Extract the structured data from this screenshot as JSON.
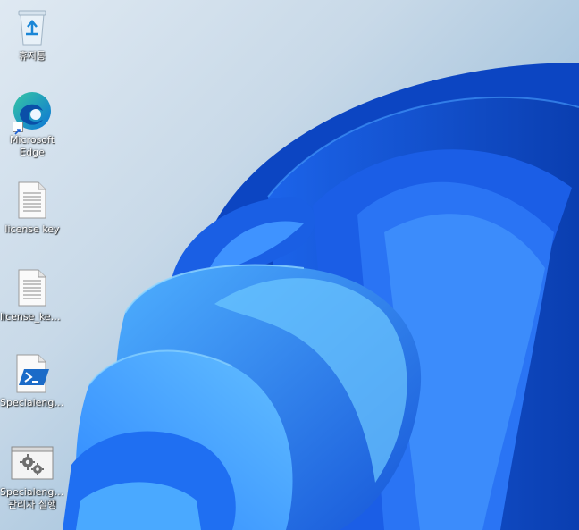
{
  "desktop": {
    "icons": [
      {
        "label": "휴지통",
        "icon": "recycle-bin-icon"
      },
      {
        "label": "Microsoft Edge",
        "icon": "edge-icon",
        "shortcut": true
      },
      {
        "label": "license key",
        "icon": "text-document-icon"
      },
      {
        "label": "license_key...",
        "icon": "text-document-icon"
      },
      {
        "label": "Specialengi...",
        "icon": "powershell-script-icon"
      },
      {
        "label": "Specialengi... 관리자 실행",
        "icon": "settings-gear-icon"
      }
    ]
  },
  "colors": {
    "bloom_dark": "#0b3fb8",
    "bloom_mid": "#1f6ef0",
    "bloom_light": "#49a6ff",
    "label_text": "#ffffff"
  }
}
